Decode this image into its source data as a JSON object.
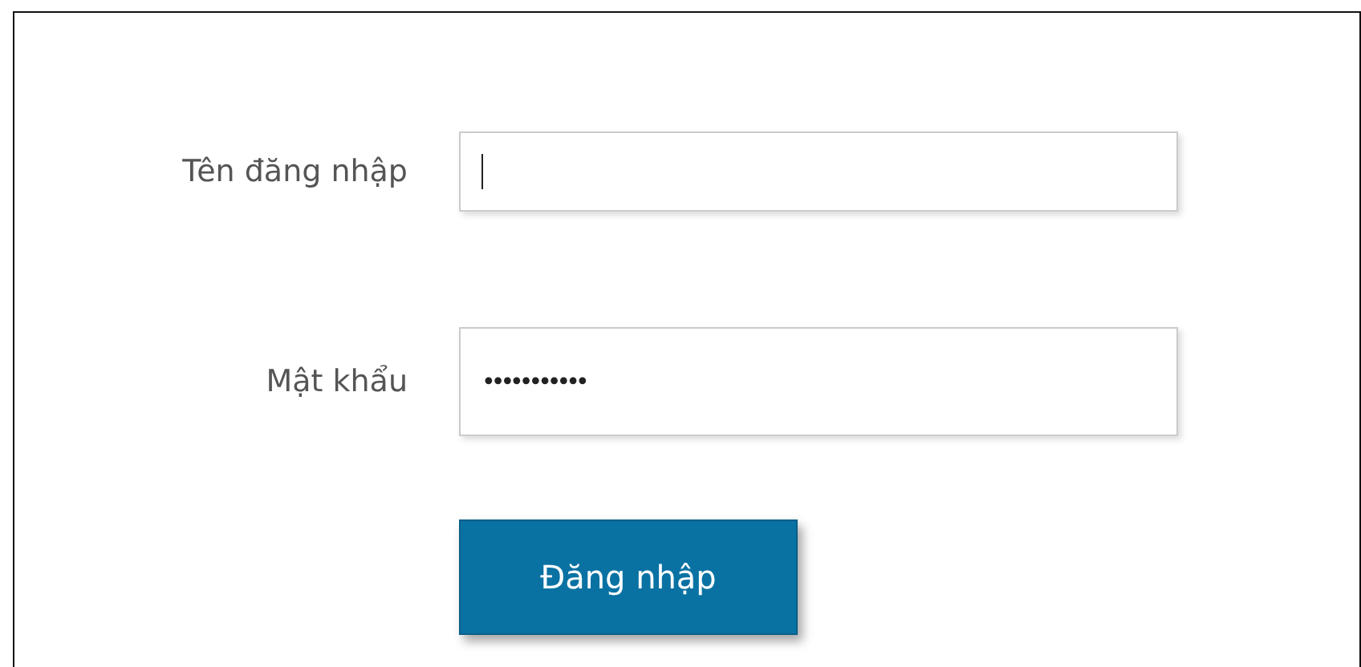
{
  "fields": [
    {
      "label": "Tên đăng nhập",
      "kind": "text",
      "focused": true
    },
    {
      "label": "Mật khẩu",
      "kind": "password",
      "value": "•••••••••••",
      "focused": false
    }
  ],
  "submit": {
    "label": "Đăng nhập"
  }
}
